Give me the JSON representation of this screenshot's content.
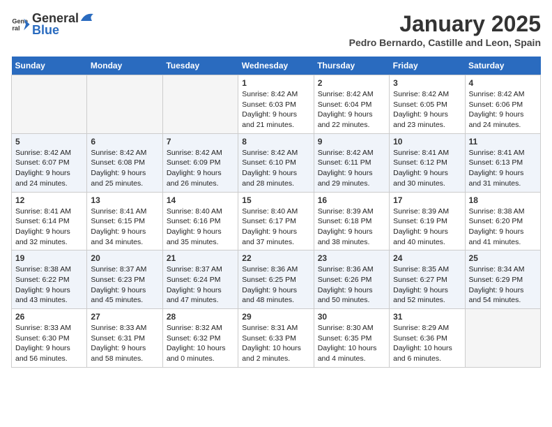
{
  "header": {
    "logo_line1": "General",
    "logo_line2": "Blue",
    "month": "January 2025",
    "location": "Pedro Bernardo, Castille and Leon, Spain"
  },
  "weekdays": [
    "Sunday",
    "Monday",
    "Tuesday",
    "Wednesday",
    "Thursday",
    "Friday",
    "Saturday"
  ],
  "weeks": [
    [
      {
        "day": "",
        "info": ""
      },
      {
        "day": "",
        "info": ""
      },
      {
        "day": "",
        "info": ""
      },
      {
        "day": "1",
        "info": "Sunrise: 8:42 AM\nSunset: 6:03 PM\nDaylight: 9 hours\nand 21 minutes."
      },
      {
        "day": "2",
        "info": "Sunrise: 8:42 AM\nSunset: 6:04 PM\nDaylight: 9 hours\nand 22 minutes."
      },
      {
        "day": "3",
        "info": "Sunrise: 8:42 AM\nSunset: 6:05 PM\nDaylight: 9 hours\nand 23 minutes."
      },
      {
        "day": "4",
        "info": "Sunrise: 8:42 AM\nSunset: 6:06 PM\nDaylight: 9 hours\nand 24 minutes."
      }
    ],
    [
      {
        "day": "5",
        "info": "Sunrise: 8:42 AM\nSunset: 6:07 PM\nDaylight: 9 hours\nand 24 minutes."
      },
      {
        "day": "6",
        "info": "Sunrise: 8:42 AM\nSunset: 6:08 PM\nDaylight: 9 hours\nand 25 minutes."
      },
      {
        "day": "7",
        "info": "Sunrise: 8:42 AM\nSunset: 6:09 PM\nDaylight: 9 hours\nand 26 minutes."
      },
      {
        "day": "8",
        "info": "Sunrise: 8:42 AM\nSunset: 6:10 PM\nDaylight: 9 hours\nand 28 minutes."
      },
      {
        "day": "9",
        "info": "Sunrise: 8:42 AM\nSunset: 6:11 PM\nDaylight: 9 hours\nand 29 minutes."
      },
      {
        "day": "10",
        "info": "Sunrise: 8:41 AM\nSunset: 6:12 PM\nDaylight: 9 hours\nand 30 minutes."
      },
      {
        "day": "11",
        "info": "Sunrise: 8:41 AM\nSunset: 6:13 PM\nDaylight: 9 hours\nand 31 minutes."
      }
    ],
    [
      {
        "day": "12",
        "info": "Sunrise: 8:41 AM\nSunset: 6:14 PM\nDaylight: 9 hours\nand 32 minutes."
      },
      {
        "day": "13",
        "info": "Sunrise: 8:41 AM\nSunset: 6:15 PM\nDaylight: 9 hours\nand 34 minutes."
      },
      {
        "day": "14",
        "info": "Sunrise: 8:40 AM\nSunset: 6:16 PM\nDaylight: 9 hours\nand 35 minutes."
      },
      {
        "day": "15",
        "info": "Sunrise: 8:40 AM\nSunset: 6:17 PM\nDaylight: 9 hours\nand 37 minutes."
      },
      {
        "day": "16",
        "info": "Sunrise: 8:39 AM\nSunset: 6:18 PM\nDaylight: 9 hours\nand 38 minutes."
      },
      {
        "day": "17",
        "info": "Sunrise: 8:39 AM\nSunset: 6:19 PM\nDaylight: 9 hours\nand 40 minutes."
      },
      {
        "day": "18",
        "info": "Sunrise: 8:38 AM\nSunset: 6:20 PM\nDaylight: 9 hours\nand 41 minutes."
      }
    ],
    [
      {
        "day": "19",
        "info": "Sunrise: 8:38 AM\nSunset: 6:22 PM\nDaylight: 9 hours\nand 43 minutes."
      },
      {
        "day": "20",
        "info": "Sunrise: 8:37 AM\nSunset: 6:23 PM\nDaylight: 9 hours\nand 45 minutes."
      },
      {
        "day": "21",
        "info": "Sunrise: 8:37 AM\nSunset: 6:24 PM\nDaylight: 9 hours\nand 47 minutes."
      },
      {
        "day": "22",
        "info": "Sunrise: 8:36 AM\nSunset: 6:25 PM\nDaylight: 9 hours\nand 48 minutes."
      },
      {
        "day": "23",
        "info": "Sunrise: 8:36 AM\nSunset: 6:26 PM\nDaylight: 9 hours\nand 50 minutes."
      },
      {
        "day": "24",
        "info": "Sunrise: 8:35 AM\nSunset: 6:27 PM\nDaylight: 9 hours\nand 52 minutes."
      },
      {
        "day": "25",
        "info": "Sunrise: 8:34 AM\nSunset: 6:29 PM\nDaylight: 9 hours\nand 54 minutes."
      }
    ],
    [
      {
        "day": "26",
        "info": "Sunrise: 8:33 AM\nSunset: 6:30 PM\nDaylight: 9 hours\nand 56 minutes."
      },
      {
        "day": "27",
        "info": "Sunrise: 8:33 AM\nSunset: 6:31 PM\nDaylight: 9 hours\nand 58 minutes."
      },
      {
        "day": "28",
        "info": "Sunrise: 8:32 AM\nSunset: 6:32 PM\nDaylight: 10 hours\nand 0 minutes."
      },
      {
        "day": "29",
        "info": "Sunrise: 8:31 AM\nSunset: 6:33 PM\nDaylight: 10 hours\nand 2 minutes."
      },
      {
        "day": "30",
        "info": "Sunrise: 8:30 AM\nSunset: 6:35 PM\nDaylight: 10 hours\nand 4 minutes."
      },
      {
        "day": "31",
        "info": "Sunrise: 8:29 AM\nSunset: 6:36 PM\nDaylight: 10 hours\nand 6 minutes."
      },
      {
        "day": "",
        "info": ""
      }
    ]
  ]
}
